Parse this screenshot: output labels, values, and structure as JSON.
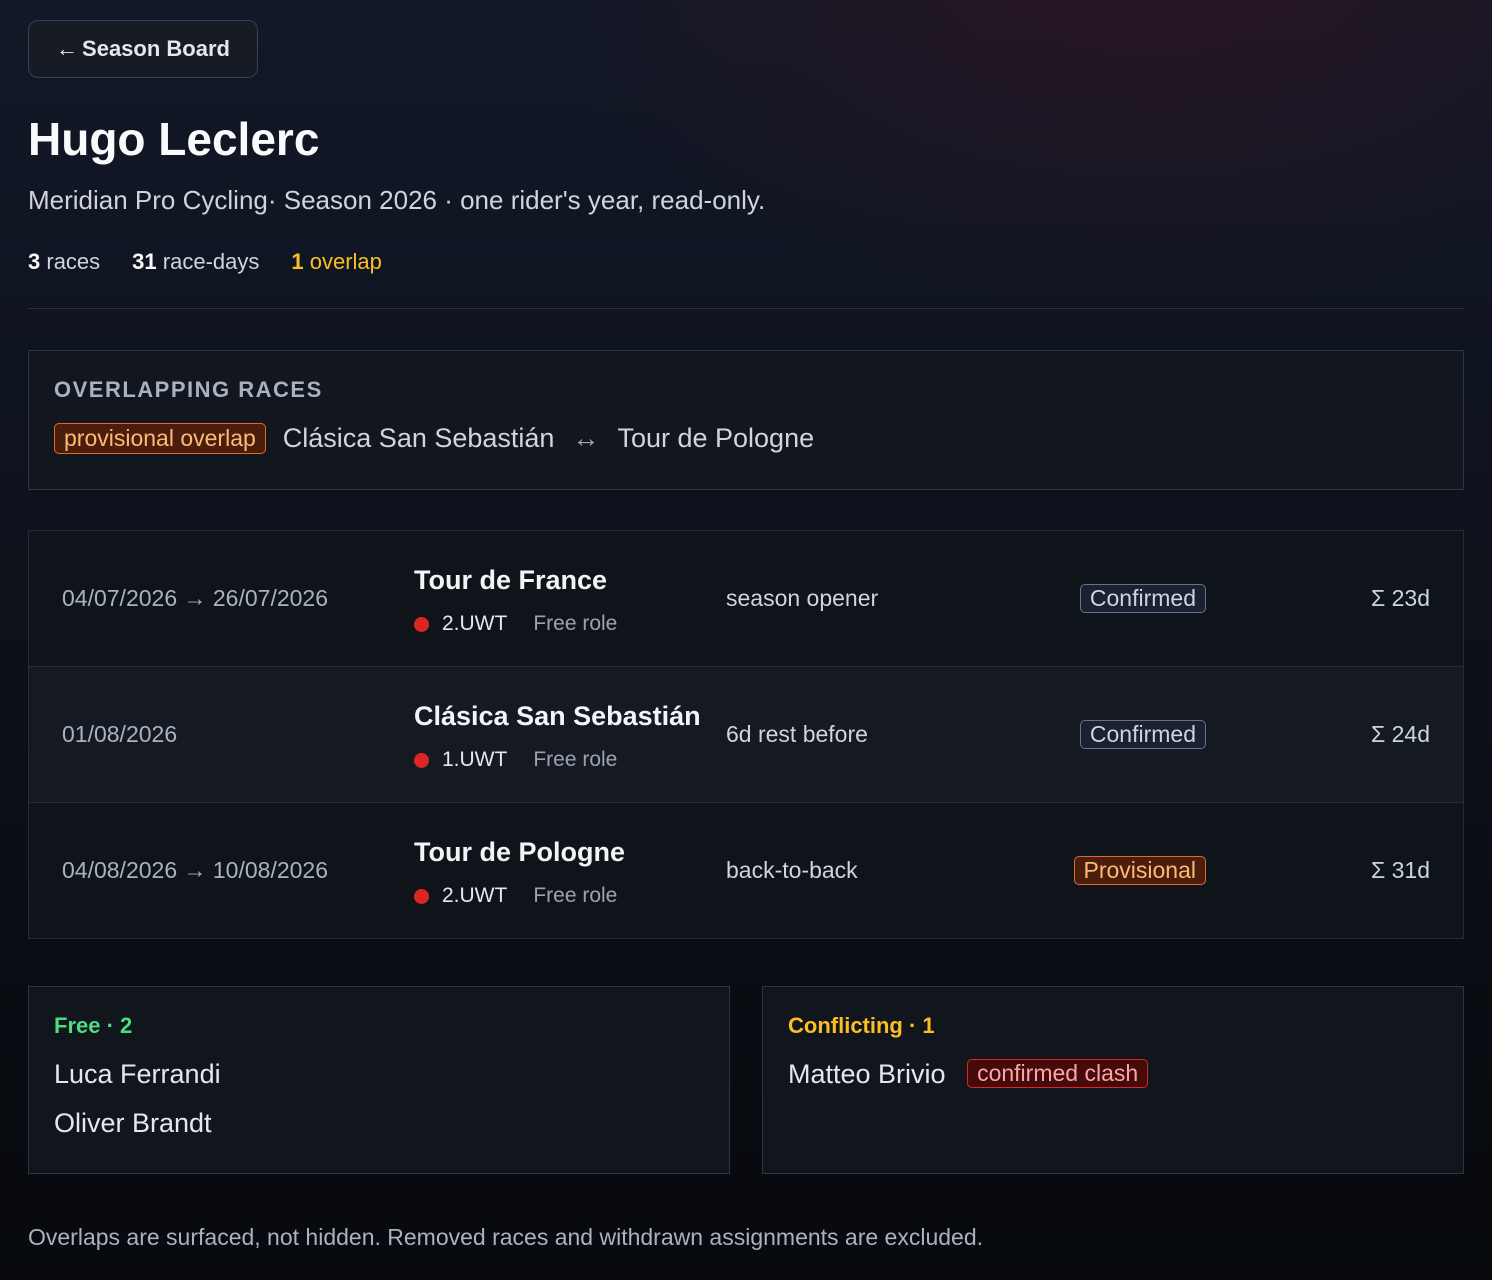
{
  "nav": {
    "back_label": "Season Board",
    "back_icon": "arrow-left-icon"
  },
  "rider": {
    "name": "Hugo Leclerc",
    "subtitle": "Meridian Pro Cycling· Season 2026 · one rider's year, read-only."
  },
  "stats": {
    "races_num": "3",
    "races_label": "races",
    "days_num": "31",
    "days_label": "race-days",
    "overlap_num": "1",
    "overlap_label": "overlap"
  },
  "overlap_panel": {
    "heading": "OVERLAPPING RACES",
    "badge": "provisional overlap",
    "race_a": "Clásica San Sebastián",
    "arrow": "↔",
    "race_b": "Tour de Pologne"
  },
  "races": [
    {
      "dates": "04/07/2026 → 26/07/2026",
      "name": "Tour de France",
      "class": "2.UWT",
      "role": "Free role",
      "note": "season opener",
      "status": "Confirmed",
      "total": "Σ 23d"
    },
    {
      "dates": "01/08/2026",
      "name": "Clásica San Sebastián",
      "class": "1.UWT",
      "role": "Free role",
      "note": "6d rest before",
      "status": "Confirmed",
      "total": "Σ 24d"
    },
    {
      "dates": "04/08/2026 → 10/08/2026",
      "name": "Tour de Pologne",
      "class": "2.UWT",
      "role": "Free role",
      "note": "back-to-back",
      "status": "Provisional",
      "total": "Σ 31d"
    }
  ],
  "free": {
    "heading": "Free · 2",
    "riders": [
      "Luca Ferrandi",
      "Oliver Brandt"
    ]
  },
  "conflicting": {
    "heading": "Conflicting · 1",
    "rider": "Matteo Brivio",
    "badge": "confirmed clash"
  },
  "footer": "Overlaps are surfaced, not hidden. Removed races and withdrawn assignments are excluded.",
  "colors": {
    "accent_orange": "#e0682c",
    "free_green": "#4ade80",
    "warn_amber": "#fbbf24",
    "clash_red": "#dc2626"
  }
}
